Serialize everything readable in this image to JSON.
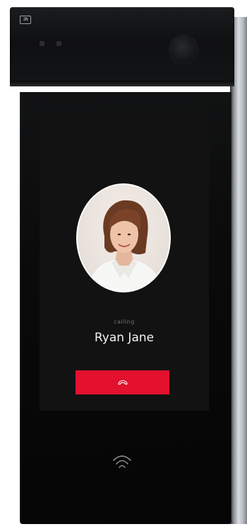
{
  "device": {
    "brand_logo": "2N"
  },
  "call": {
    "status": "calling",
    "caller_name": "Ryan Jane",
    "hangup_icon": "phone-hangup-icon"
  },
  "reader": {
    "icon": "nfc-wireless-icon"
  },
  "colors": {
    "hangup": "#e3102e",
    "screen": "#121212",
    "body": "#0a0a0a"
  }
}
